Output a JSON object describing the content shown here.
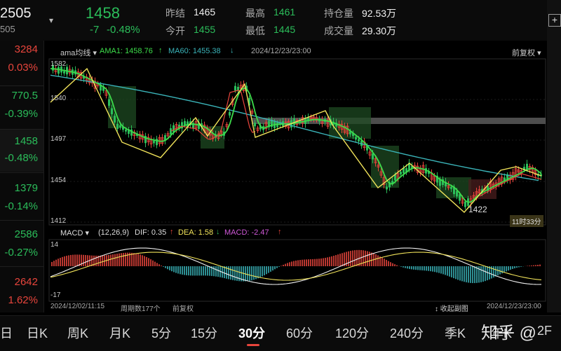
{
  "header": {
    "contract_code": "2505",
    "contract_sub": "505",
    "last_price": "1458",
    "change": "-7",
    "change_pct": "-0.48%",
    "prev_close_label": "昨结",
    "prev_close": "1465",
    "open_label": "今开",
    "open": "1455",
    "high_label": "最高",
    "high": "1461",
    "low_label": "最低",
    "low": "1445",
    "oi_label": "持仓量",
    "oi": "92.53万",
    "volume_label": "成交量",
    "volume": "29.30万"
  },
  "left_list": [
    {
      "price": "3284",
      "pct": "0.03%",
      "color": "#e8453c"
    },
    {
      "price": "770.5",
      "pct": "-0.39%",
      "color": "#2bbd5a"
    },
    {
      "price": "1458",
      "pct": "-0.48%",
      "color": "#2bbd5a"
    },
    {
      "price": "1379",
      "pct": "-0.14%",
      "color": "#2bbd5a"
    },
    {
      "price": "2586",
      "pct": "-0.27%",
      "color": "#2bbd5a"
    },
    {
      "price": "2642",
      "pct": "1.62%",
      "color": "#e8453c"
    }
  ],
  "main_chart": {
    "indicator_label": "ama均线",
    "ama_label": "AMA1: 1458.76",
    "ma60_label": "MA60: 1455.38",
    "timestamp": "2024/12/23/23:00",
    "adjust_label": "前复权",
    "y_ticks": [
      "1582",
      "1540",
      "1497",
      "1454",
      "1412"
    ],
    "low_marker": "1422",
    "countdown": "11时33分"
  },
  "macd": {
    "name": "MACD",
    "params": "(12,26,9)",
    "dif": "DIF: 0.35",
    "dea": "DEA: 1.58",
    "macd": "MACD: -2.47",
    "y_top": "14",
    "y_bottom": "-17",
    "start_time": "2024/12/02/11:15",
    "period_count": "周期数177个",
    "adjust": "前复权",
    "collapse": "收起副图",
    "end_time": "2024/12/23/23:00"
  },
  "tabs": [
    "日",
    "日K",
    "周K",
    "月K",
    "5分",
    "15分",
    "30分",
    "60分",
    "120分",
    "240分",
    "季K",
    "年K",
    "2F"
  ],
  "active_tab": "30分",
  "watermark": "知乎 @",
  "colors": {
    "up": "#e8453c",
    "down": "#2bbd5a",
    "ama": "#3ddc4a",
    "ma60": "#3ab3b8",
    "zigzag": "#f1e35a"
  }
}
